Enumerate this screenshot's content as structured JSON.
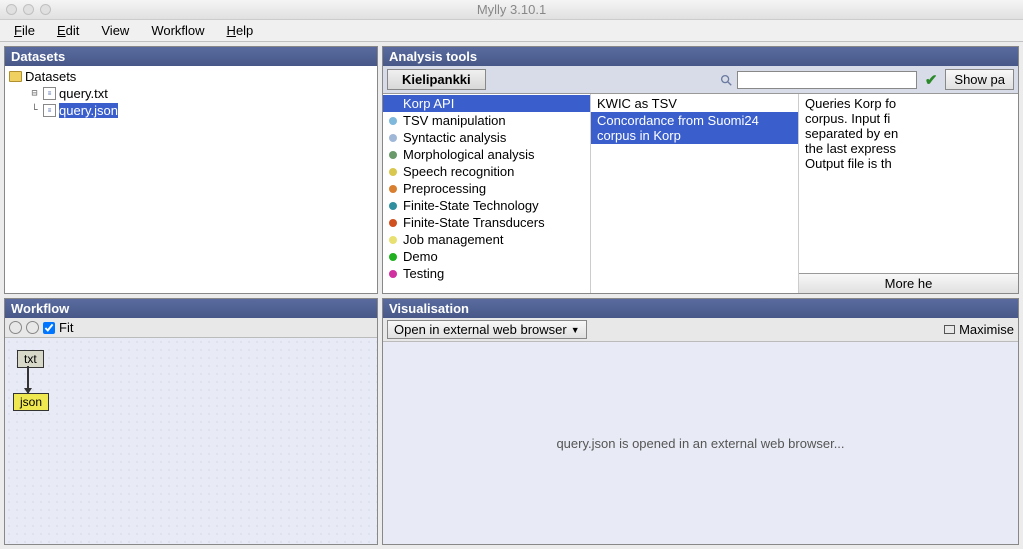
{
  "window": {
    "title": "Mylly 3.10.1"
  },
  "menu": {
    "file": "ile",
    "file_u": "F",
    "edit": "dit",
    "edit_u": "E",
    "view": "View",
    "workflow": "Workflow",
    "help": "elp",
    "help_u": "H"
  },
  "datasets": {
    "title": "Datasets",
    "root": "Datasets",
    "files": [
      "query.txt",
      "query.json"
    ]
  },
  "analysis": {
    "title": "Analysis tools",
    "tab": "Kielipankki",
    "show_params": "Show pa",
    "categories": [
      {
        "label": "Korp API",
        "color": "#3a5fcd",
        "selected": true
      },
      {
        "label": "TSV manipulation",
        "color": "#7eb8da"
      },
      {
        "label": "Syntactic analysis",
        "color": "#a0b8d8"
      },
      {
        "label": "Morphological analysis",
        "color": "#6a9a6a"
      },
      {
        "label": "Speech recognition",
        "color": "#d8c850"
      },
      {
        "label": "Preprocessing",
        "color": "#d88030"
      },
      {
        "label": "Finite-State Technology",
        "color": "#3090a0"
      },
      {
        "label": "Finite-State Transducers",
        "color": "#d05020"
      },
      {
        "label": "Job management",
        "color": "#e8e070"
      },
      {
        "label": "Demo",
        "color": "#20b020"
      },
      {
        "label": "Testing",
        "color": "#d030a0"
      }
    ],
    "tools": [
      {
        "label": "KWIC as TSV",
        "selected": false
      },
      {
        "label": "Concordance from Suomi24 corpus in Korp",
        "selected": true
      }
    ],
    "description": "Queries Korp fo\ncorpus. Input fi\nseparated by en\nthe last express\nOutput file is th",
    "more": "More he"
  },
  "workflow": {
    "title": "Workflow",
    "fit": "Fit",
    "nodes": {
      "txt": "txt",
      "json": "json"
    }
  },
  "visualisation": {
    "title": "Visualisation",
    "dropdown": "Open in external web browser",
    "maximise": "Maximise",
    "message": "query.json is opened in an external web browser..."
  }
}
